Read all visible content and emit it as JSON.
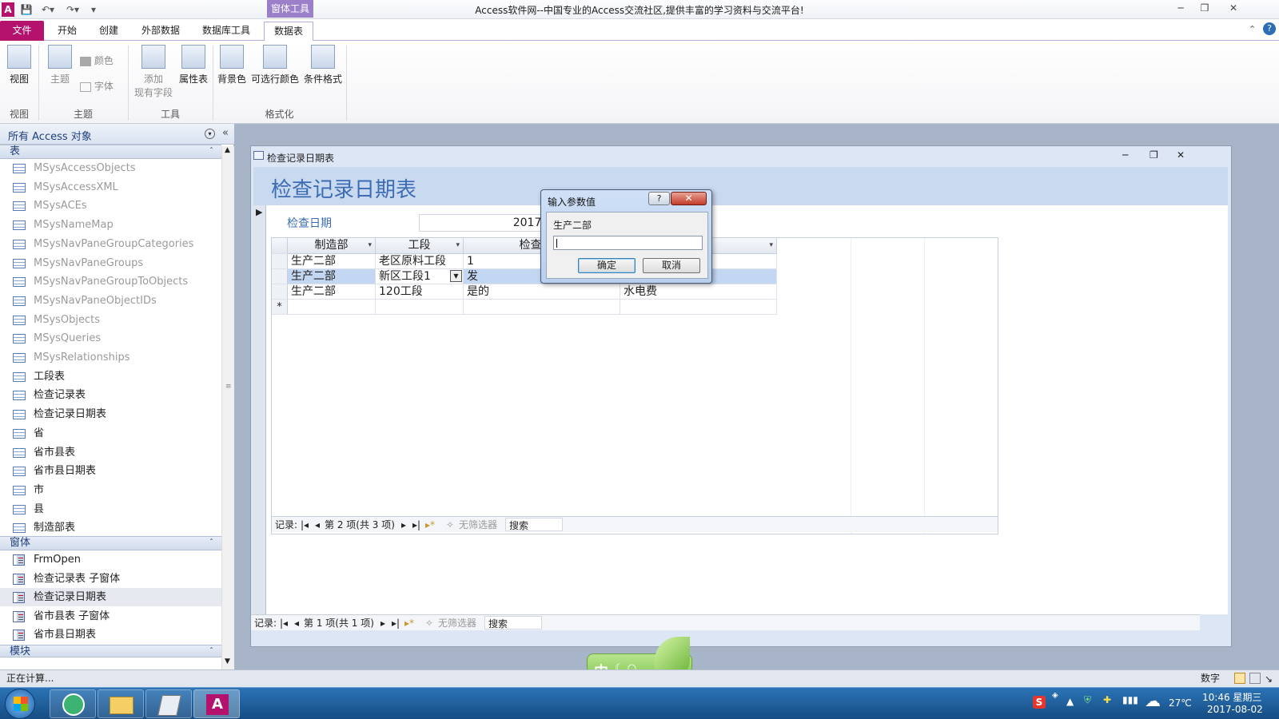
{
  "window": {
    "title": "Access软件网--中国专业的Access交流社区,提供丰富的学习资料与交流平台!",
    "contextual_tab_group": "窗体工具"
  },
  "ribbon": {
    "tabs": [
      {
        "label": "文件"
      },
      {
        "label": "开始"
      },
      {
        "label": "创建"
      },
      {
        "label": "外部数据"
      },
      {
        "label": "数据库工具"
      },
      {
        "label": "数据表"
      }
    ],
    "buttons": {
      "view": "视图",
      "theme": "主题",
      "colors": "颜色",
      "fonts": "字体",
      "add_field_1": "添加",
      "add_field_2": "现有字段",
      "property_sheet": "属性表",
      "bg_color": "背景色",
      "alt_row_color": "可选行颜色",
      "cond_format": "条件格式"
    },
    "groups": {
      "views": "视图",
      "themes": "主题",
      "tools": "工具",
      "formatting": "格式化"
    }
  },
  "nav_pane": {
    "header": "所有 Access 对象",
    "sections": {
      "tables": "表",
      "forms": "窗体",
      "modules": "模块"
    },
    "tables": [
      {
        "name": "MSysAccessObjects",
        "system": true
      },
      {
        "name": "MSysAccessXML",
        "system": true
      },
      {
        "name": "MSysACEs",
        "system": true
      },
      {
        "name": "MSysNameMap",
        "system": true
      },
      {
        "name": "MSysNavPaneGroupCategories",
        "system": true
      },
      {
        "name": "MSysNavPaneGroups",
        "system": true
      },
      {
        "name": "MSysNavPaneGroupToObjects",
        "system": true
      },
      {
        "name": "MSysNavPaneObjectIDs",
        "system": true
      },
      {
        "name": "MSysObjects",
        "system": true
      },
      {
        "name": "MSysQueries",
        "system": true
      },
      {
        "name": "MSysRelationships",
        "system": true
      },
      {
        "name": "工段表",
        "system": false
      },
      {
        "name": "检查记录表",
        "system": false
      },
      {
        "name": "检查记录日期表",
        "system": false
      },
      {
        "name": "省",
        "system": false
      },
      {
        "name": "省市县表",
        "system": false
      },
      {
        "name": "省市县日期表",
        "system": false
      },
      {
        "name": "市",
        "system": false
      },
      {
        "name": "县",
        "system": false
      },
      {
        "name": "制造部表",
        "system": false
      }
    ],
    "forms": [
      {
        "name": "FrmOpen"
      },
      {
        "name": "检查记录表 子窗体"
      },
      {
        "name": "检查记录日期表",
        "selected": true
      },
      {
        "name": "省市县表 子窗体"
      },
      {
        "name": "省市县日期表"
      }
    ]
  },
  "form": {
    "window_title": "检查记录日期表",
    "header_title": "检查记录日期表",
    "date_label": "检查日期",
    "date_value": "2017/8",
    "subform": {
      "columns": [
        "制造部",
        "工段",
        "检查内容",
        ""
      ],
      "rows": [
        [
          "生产二部",
          "老区原料工段",
          "1",
          ""
        ],
        [
          "生产二部",
          "新区工段1",
          "发",
          ""
        ],
        [
          "生产二部",
          "120工段",
          "是的",
          "水电费"
        ]
      ],
      "new_row_marker": "*",
      "record_nav": {
        "label": "记录:",
        "position": "第 2 项(共 3 项)",
        "filter": "无筛选器",
        "search": "搜索"
      }
    },
    "record_nav": {
      "label": "记录:",
      "position": "第 1 项(共 1 项)",
      "filter": "无筛选器",
      "search": "搜索"
    }
  },
  "dialog": {
    "title": "输入参数值",
    "help": "?",
    "prompt": "生产二部",
    "input_value": "",
    "ok": "确定",
    "cancel": "取消"
  },
  "status": {
    "left": "正在计算...",
    "mode": "数字"
  },
  "ime": {
    "label": "中"
  },
  "tray": {
    "temperature": "27℃",
    "time": "10:46 星期三",
    "date": "2017-08-02"
  }
}
